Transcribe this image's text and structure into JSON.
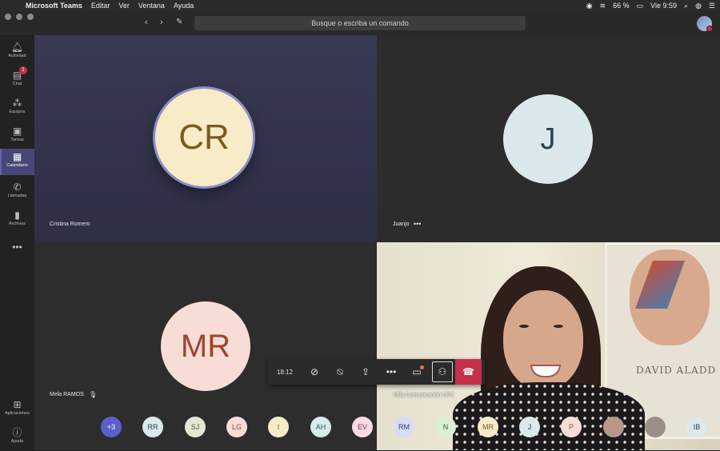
{
  "menubar": {
    "app": "Microsoft Teams",
    "items": [
      "Editar",
      "Ver",
      "Ventana",
      "Ayuda"
    ],
    "battery": "66 %",
    "clock": "Vie 9:59"
  },
  "search": {
    "placeholder": "Busque o escriba un comando"
  },
  "sidebar": {
    "items": [
      {
        "label": "Actividad",
        "icon": "bell-icon"
      },
      {
        "label": "Chat",
        "icon": "chat-icon",
        "badge": "1"
      },
      {
        "label": "Equipos",
        "icon": "teams-icon"
      },
      {
        "label": "Tareas",
        "icon": "tasks-icon"
      },
      {
        "label": "Calendario",
        "icon": "calendar-icon",
        "active": true
      },
      {
        "label": "Llamadas",
        "icon": "phone-icon"
      },
      {
        "label": "Archivos",
        "icon": "file-icon"
      }
    ],
    "more": "•••",
    "bottom": [
      {
        "label": "Aplicaciones",
        "icon": "apps-icon"
      },
      {
        "label": "Ayuda",
        "icon": "help-icon"
      }
    ]
  },
  "stage": {
    "tiles": [
      {
        "initials": "CR",
        "name": "Cristina Romero",
        "avatar_bg": "#f8ecc8",
        "avatar_fg": "#7a5a1e",
        "speaking": true
      },
      {
        "initials": "J",
        "name": "Juanjo",
        "avatar_bg": "#dbe8ec",
        "avatar_fg": "#264650"
      },
      {
        "initials": "MR",
        "name": "Mela RAMOS",
        "avatar_bg": "#f8ddd6",
        "avatar_fg": "#9d4530"
      },
      {
        "name": "Mila Comunicación UPC",
        "poster_text": "DAVID  ALADD"
      }
    ]
  },
  "callbar": {
    "time": "18:12",
    "buttons": [
      "camera-off-icon",
      "mic-off-icon",
      "share-screen-icon",
      "more-icon",
      "chat-icon",
      "participants-icon",
      "hang-up-icon"
    ]
  },
  "participants": [
    {
      "initials": "+3",
      "bg": "#5b5fc7",
      "fg": "#ffffff"
    },
    {
      "initials": "RR",
      "bg": "#dbe8ec",
      "fg": "#264650"
    },
    {
      "initials": "SJ",
      "bg": "#e3e7d2",
      "fg": "#4f5430"
    },
    {
      "initials": "LG",
      "bg": "#f8ddd6",
      "fg": "#9d4530"
    },
    {
      "initials": "I",
      "bg": "#f8ecc8",
      "fg": "#7a5a1e"
    },
    {
      "initials": "AH",
      "bg": "#d6ecea",
      "fg": "#1e5e58"
    },
    {
      "initials": "EV",
      "bg": "#f7dbe2",
      "fg": "#8c2d46"
    },
    {
      "initials": "RM",
      "bg": "#dadcf1",
      "fg": "#3c3e8a"
    },
    {
      "initials": "N",
      "bg": "#dcefd6",
      "fg": "#36642b"
    },
    {
      "initials": "MR",
      "bg": "#f8ecc8",
      "fg": "#7a5a1e"
    },
    {
      "initials": "J",
      "bg": "#dbe8ec",
      "fg": "#264650"
    },
    {
      "initials": "P",
      "bg": "#f8ddd6",
      "fg": "#9d4530"
    },
    {
      "initials": "",
      "bg": "#b8978a",
      "fg": "#ffffff",
      "photo": true
    },
    {
      "initials": "",
      "bg": "#9a8f86",
      "fg": "#ffffff",
      "photo": true
    },
    {
      "initials": "IB",
      "bg": "#dbe8ec",
      "fg": "#264650"
    }
  ]
}
